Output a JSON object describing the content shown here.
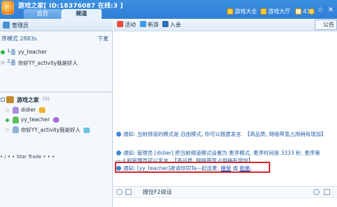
{
  "window": {
    "title": "游戏之家[ ID:18376087 在线:3 ]"
  },
  "tabs": [
    {
      "label": "首页"
    },
    {
      "label": "频道"
    }
  ],
  "topbar": {
    "game_hall": "游戏大全",
    "game_lobby": "游戏大厅",
    "mail_count": "43"
  },
  "left": {
    "admin_label": "管理员",
    "mode_text": "序模式 2883s",
    "mode_action": "下麦",
    "queue": [
      {
        "num": "1.",
        "name": "yy_teacher"
      },
      {
        "num": "2.",
        "name": "你好YY_activity我是好人"
      }
    ],
    "channel_name": "游戏之家",
    "channel_count": "(3)",
    "members": [
      {
        "name": "didier"
      },
      {
        "name": "yy_teacher"
      },
      {
        "name": "你好YY_activity我是好人"
      }
    ],
    "track_text": "• / • • Star Trade • • •"
  },
  "right": {
    "toolbar": {
      "activity": "活动",
      "new_game": "新游",
      "join": "入会",
      "announce": "公告"
    },
    "messages": {
      "m1": "通知: 当前频道的模式是 自由模式, 你可以随意发言. 【高品质, 网络带宽占用稍有增加】",
      "m2_line1": "通知: 管理员 [didier] 把当前频道模式设置为 麦序模式, 麦序时间是 3333 秒, 麦序第",
      "m2_line2": "一人和管理员可以发言. 【高品质, 网络带宽占用稍有增加】",
      "m3_prefix": "通知: [yy_teacher]邀请你同Ta一起连麦, ",
      "m3_accept": "接受",
      "m3_mid": " 或 ",
      "m3_reject": "拒绝",
      "m3_suffix": "。"
    },
    "talk_button": "按住F2说话"
  },
  "colors": {
    "titlebar": "#3a8fe0",
    "highlight_border": "#e0232a",
    "link": "#0b3fb3"
  }
}
